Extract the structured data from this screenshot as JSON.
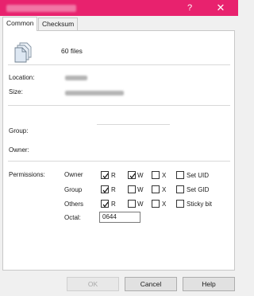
{
  "window": {
    "title": "",
    "help_glyph": "?",
    "close_glyph": "✕"
  },
  "tabs": [
    {
      "label": "Common",
      "active": true
    },
    {
      "label": "Checksum",
      "active": false
    }
  ],
  "summary": {
    "icon": "files-icon",
    "text": "60 files"
  },
  "fields": {
    "location_label": "Location:",
    "size_label": "Size:",
    "group_label": "Group:",
    "owner_label": "Owner:"
  },
  "permissions": {
    "label": "Permissions:",
    "rows": [
      {
        "label": "Owner",
        "r": true,
        "w": true,
        "x": false,
        "extra_label": "Set UID",
        "extra": false
      },
      {
        "label": "Group",
        "r": true,
        "w": false,
        "x": false,
        "extra_label": "Set GID",
        "extra": false
      },
      {
        "label": "Others",
        "r": true,
        "w": false,
        "x": false,
        "extra_label": "Sticky bit",
        "extra": false
      }
    ],
    "r_label": "R",
    "w_label": "W",
    "x_label": "X",
    "octal_label": "Octal:",
    "octal_value": "0644"
  },
  "buttons": {
    "ok": "OK",
    "cancel": "Cancel",
    "help": "Help"
  },
  "colors": {
    "titlebar": "#e8226e"
  }
}
